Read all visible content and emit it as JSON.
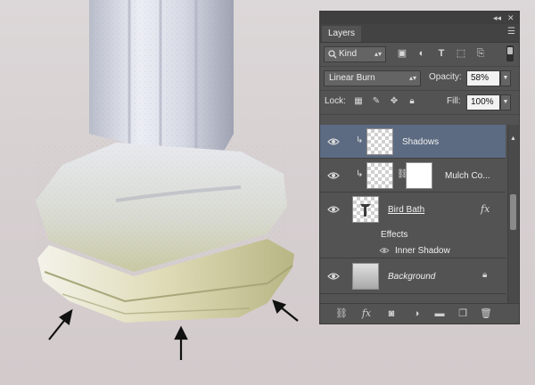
{
  "panel": {
    "collapse_glyph": "◂◂",
    "close_glyph": "✕",
    "menu_glyph": "☰",
    "tab_label": "Layers"
  },
  "filter": {
    "kind_label": "Kind",
    "icons": [
      "image-filter-icon",
      "adjustment-filter-icon",
      "type-filter-icon",
      "shape-filter-icon",
      "smart-object-filter-icon"
    ]
  },
  "blend": {
    "mode": "Linear Burn",
    "opacity_label": "Opacity:",
    "opacity_value": "58%"
  },
  "lock": {
    "label": "Lock:",
    "fill_label": "Fill:",
    "fill_value": "100%"
  },
  "layers": [
    {
      "name": "Shadows",
      "selected": true,
      "clipped": true
    },
    {
      "name": "Mulch Co...",
      "clipped": true,
      "has_mask": true
    },
    {
      "name": "Bird Bath",
      "fx": "fx",
      "effects_label": "Effects",
      "effect_item": "Inner Shadow"
    },
    {
      "name": "Background",
      "locked": true
    }
  ],
  "colors": {
    "panel_bg": "#535353",
    "selection": "#5c6b82",
    "canvas_bg": "#d8d1d2"
  }
}
